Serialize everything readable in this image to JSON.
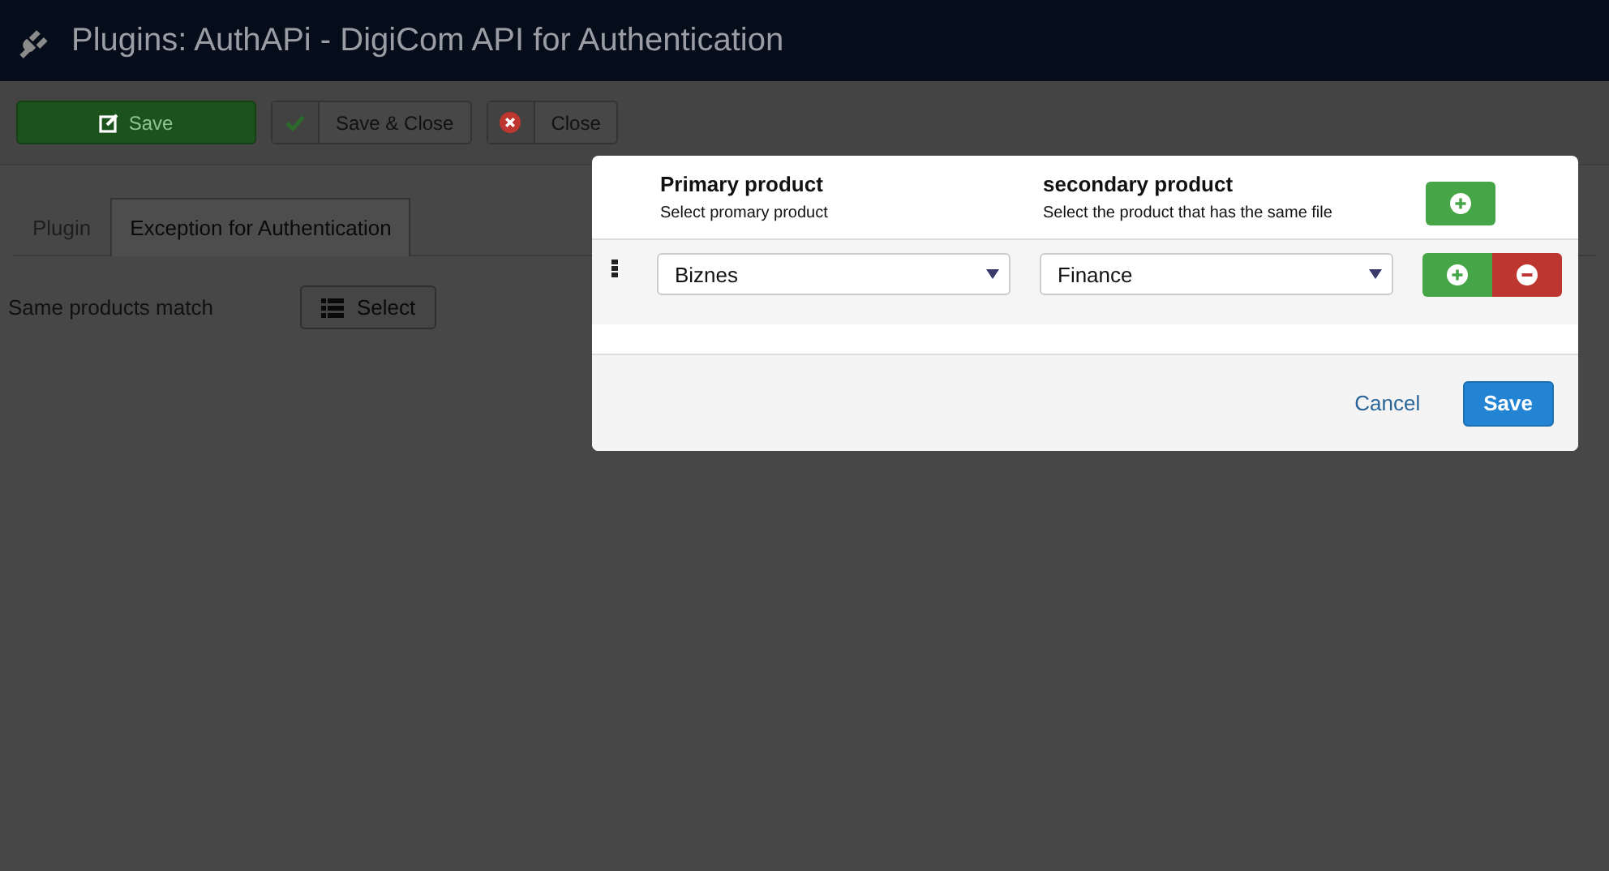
{
  "window": {
    "title": "Plugins: AuthAPi - DigiCom API for Authentication"
  },
  "toolbar": [
    {
      "label": "Save",
      "kind": "primary"
    },
    {
      "label": "Save & Close",
      "kind": "check"
    },
    {
      "label": "Close",
      "kind": "close"
    }
  ],
  "tabs": [
    {
      "label": "Plugin",
      "selected": false
    },
    {
      "label": "Exception for Authentication",
      "selected": true
    }
  ],
  "field": {
    "label": "Same products match",
    "button": "Select"
  },
  "modal": {
    "columns": [
      {
        "title": "Primary product",
        "hint": "Select promary product"
      },
      {
        "title": "secondary product",
        "hint": "Select the product that has the same file"
      }
    ],
    "rows": [
      {
        "primary": "Biznes",
        "secondary": "Finance"
      }
    ],
    "actions": [
      {
        "label": "Cancel",
        "kind": "link"
      },
      {
        "label": "Save",
        "kind": "primary"
      }
    ]
  }
}
